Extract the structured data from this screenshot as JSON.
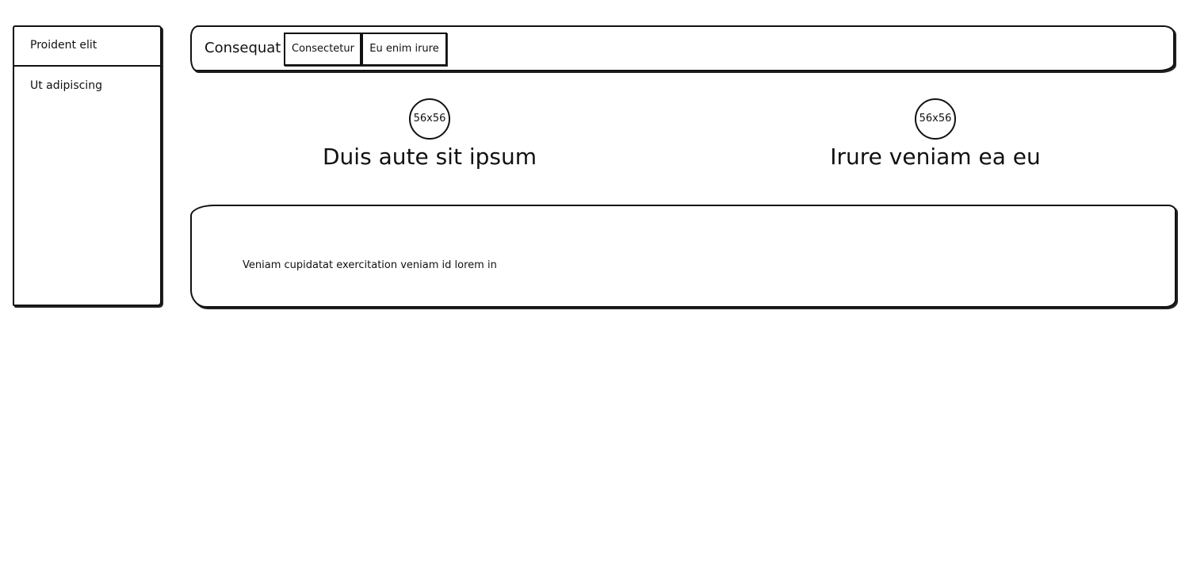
{
  "sidebar": {
    "items": [
      {
        "label": "Proident elit"
      },
      {
        "label": "Ut adipiscing"
      }
    ]
  },
  "header": {
    "title": "Consequat",
    "buttons": [
      {
        "label": "Consectetur"
      },
      {
        "label": "Eu enim irure"
      }
    ]
  },
  "profiles": [
    {
      "avatar_text": "56x56",
      "name": "Duis aute sit ipsum"
    },
    {
      "avatar_text": "56x56",
      "name": "Irure veniam ea eu"
    }
  ],
  "content": {
    "text": "Veniam cupidatat exercitation veniam id lorem in"
  }
}
